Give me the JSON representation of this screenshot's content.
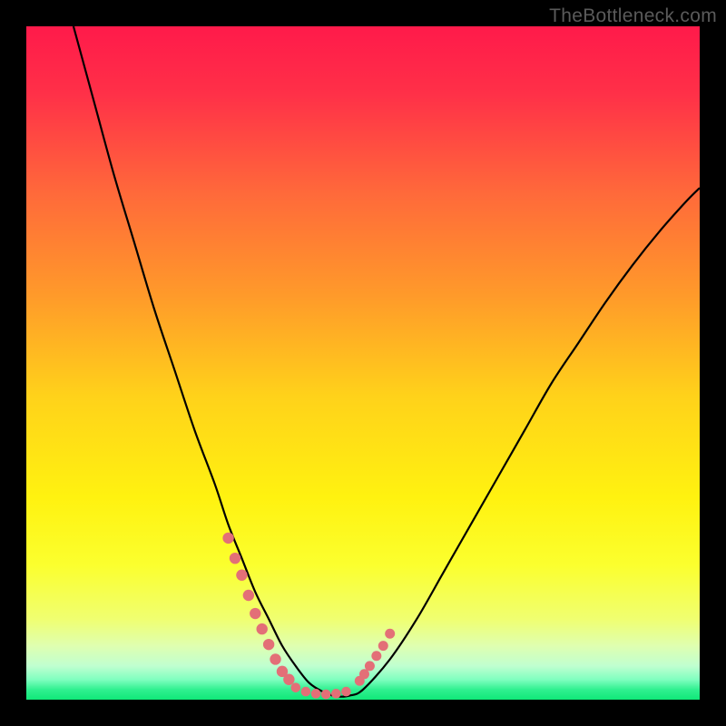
{
  "watermark": "TheBottleneck.com",
  "chart_data": {
    "type": "line",
    "title": "",
    "xlabel": "",
    "ylabel": "",
    "xlim": [
      0,
      100
    ],
    "ylim": [
      0,
      100
    ],
    "gradient_stops": [
      {
        "offset": 0.0,
        "color": "#ff1a4a"
      },
      {
        "offset": 0.1,
        "color": "#ff3048"
      },
      {
        "offset": 0.25,
        "color": "#ff6a3a"
      },
      {
        "offset": 0.4,
        "color": "#ff9a2a"
      },
      {
        "offset": 0.55,
        "color": "#ffd21a"
      },
      {
        "offset": 0.7,
        "color": "#fff210"
      },
      {
        "offset": 0.8,
        "color": "#fbff2e"
      },
      {
        "offset": 0.88,
        "color": "#f0ff70"
      },
      {
        "offset": 0.92,
        "color": "#dfffb0"
      },
      {
        "offset": 0.95,
        "color": "#c0ffd0"
      },
      {
        "offset": 0.97,
        "color": "#80ffc0"
      },
      {
        "offset": 0.985,
        "color": "#30f090"
      },
      {
        "offset": 1.0,
        "color": "#10e878"
      }
    ],
    "series": [
      {
        "name": "bottleneck-curve",
        "x": [
          7,
          10,
          13,
          16,
          19,
          22,
          25,
          28,
          30,
          32,
          34,
          36,
          38,
          40,
          42,
          44,
          46,
          48,
          50,
          54,
          58,
          62,
          66,
          70,
          74,
          78,
          82,
          86,
          90,
          94,
          98,
          100
        ],
        "y": [
          100,
          89,
          78,
          68,
          58,
          49,
          40,
          32,
          26,
          21,
          16,
          12,
          8,
          5,
          2.5,
          1.2,
          0.5,
          0.6,
          1.5,
          6,
          12,
          19,
          26,
          33,
          40,
          47,
          53,
          59,
          64.5,
          69.5,
          74,
          76
        ]
      }
    ],
    "highlight_points": {
      "name": "optimal-range-markers",
      "color": "#e36f77",
      "left_cluster": [
        [
          30,
          24
        ],
        [
          31,
          21
        ],
        [
          32,
          18.5
        ],
        [
          33,
          15.5
        ],
        [
          34,
          12.8
        ],
        [
          35,
          10.5
        ],
        [
          36,
          8.2
        ],
        [
          37,
          6
        ],
        [
          38,
          4.2
        ],
        [
          39,
          3
        ]
      ],
      "bottom_cluster": [
        [
          40,
          1.8
        ],
        [
          41.5,
          1.2
        ],
        [
          43,
          0.9
        ],
        [
          44.5,
          0.8
        ],
        [
          46,
          0.9
        ],
        [
          47.5,
          1.2
        ]
      ],
      "right_cluster": [
        [
          49.5,
          2.8
        ],
        [
          50.2,
          3.8
        ],
        [
          51,
          5
        ],
        [
          52,
          6.5
        ],
        [
          53,
          8
        ],
        [
          54,
          9.8
        ]
      ]
    }
  }
}
